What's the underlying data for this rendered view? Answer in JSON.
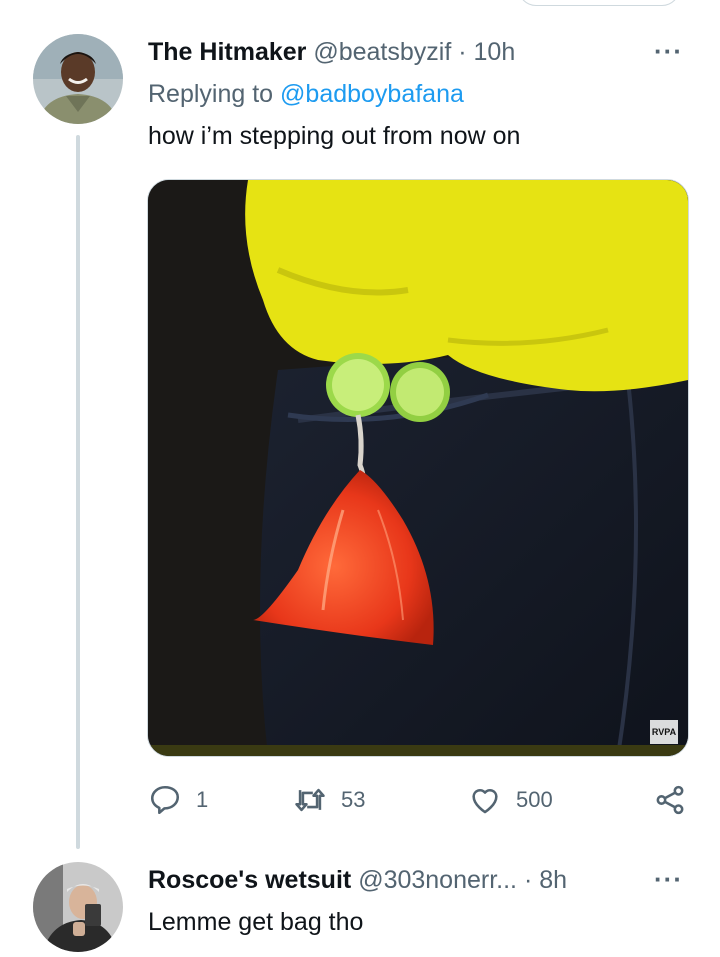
{
  "tweet": {
    "author_name": "The Hitmaker",
    "author_handle": "@beatsbyzif",
    "separator": "·",
    "time": "10h",
    "replying_prefix": "Replying to",
    "replying_handle": "@badboybafana",
    "text": "how i’m stepping out from now on",
    "more_label": "···",
    "media_watermark": "RVPA",
    "actions": {
      "replies": "1",
      "retweets": "53",
      "likes": "500"
    }
  },
  "reply": {
    "author_name": "Roscoe's wetsuit",
    "author_handle": "@303nonerr...",
    "separator": "·",
    "time": "8h",
    "text": "Lemme get bag tho",
    "more_label": "···"
  },
  "colors": {
    "link": "#1d9bf0",
    "muted": "#536471",
    "thread_line": "#cfd9de"
  },
  "icons": [
    "reply-icon",
    "retweet-icon",
    "like-icon",
    "share-icon",
    "more-icon"
  ]
}
